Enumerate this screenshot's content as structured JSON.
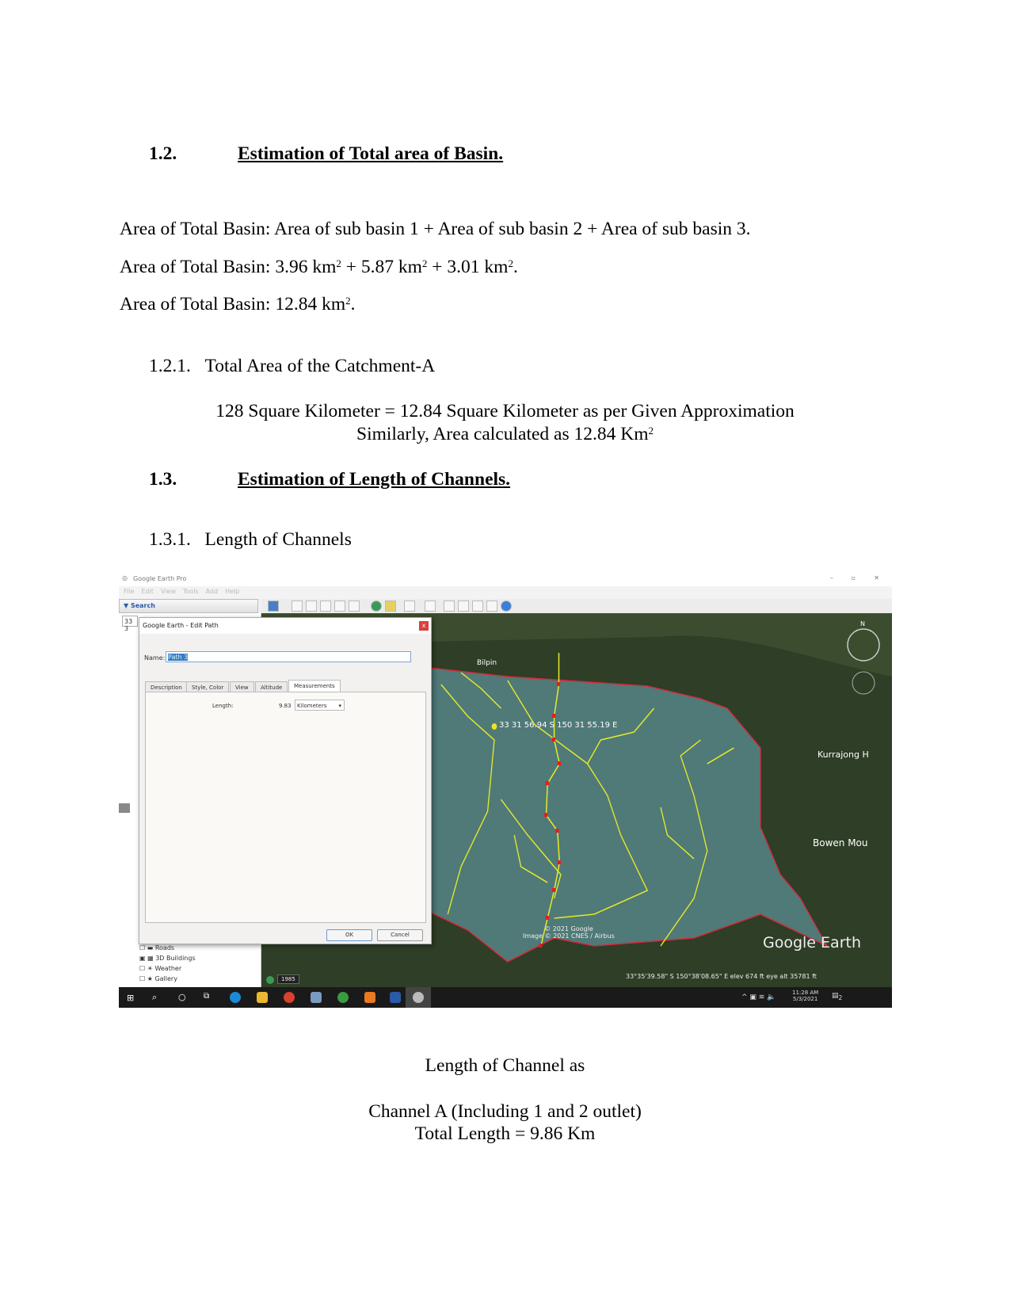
{
  "section_1_2": {
    "number": "1.2.",
    "title": "Estimation of Total area of Basin."
  },
  "paragraphs": {
    "line1": "Area of Total Basin: Area of sub basin 1 + Area of sub basin 2 + Area of sub basin 3.",
    "line2_prefix": "Area of Total Basin: 3.96 km",
    "line2_a": " + 5.87 km",
    "line2_b": " + 3.01 km",
    "line2_end": ".",
    "line3_prefix": "Area of Total Basin: 12.84 km",
    "line3_end": ".",
    "sup": "2"
  },
  "section_1_2_1": {
    "number": "1.2.1.",
    "title": "Total Area of the Catchment-A"
  },
  "catchment": {
    "line1": "128 Square Kilometer = 12.84 Square Kilometer as per Given Approximation",
    "line2": "Similarly, Area calculated as 12.84 Km",
    "sup": "2"
  },
  "section_1_3": {
    "number": "1.3.",
    "title": "Estimation of Length of Channels."
  },
  "section_1_3_1": {
    "number": "1.3.1.",
    "title": "Length of Channels"
  },
  "screenshot": {
    "app_title": "Google Earth Pro",
    "menu": [
      "File",
      "Edit",
      "View",
      "Tools",
      "Add",
      "Help"
    ],
    "search_label": "▼ Search",
    "search_value": "33 3",
    "dialog": {
      "title": "Google Earth - Edit Path",
      "close": "x",
      "name_label": "Name:",
      "name_value": "Path 3",
      "tabs": [
        "Description",
        "Style, Color",
        "View",
        "Altitude",
        "Measurements"
      ],
      "active_tab": "Measurements",
      "length_label": "Length:",
      "length_value": "9.83",
      "unit": "Kilometers",
      "ok": "OK",
      "cancel": "Cancel"
    },
    "layers": [
      "Roads",
      "3D Buildings",
      "Weather",
      "Gallery"
    ],
    "map": {
      "placemark_label": "33 31 56.94 S 150 31 55.19 E",
      "places": [
        "Bilpin",
        "Kurrajong H",
        "Bowen Mou"
      ],
      "copyright1": "© 2021 Google",
      "copyright2": "Image © 2021 CNES / Airbus",
      "logo": "Google Earth",
      "historical_year": "1985",
      "compass_n": "N",
      "status": "33°35'39.58\" S  150°38'08.65\" E  elev  674 ft     eye alt  35781 ft"
    },
    "taskbar": {
      "time": "11:28 AM",
      "date": "5/3/2021",
      "notifications": "2"
    }
  },
  "caption": {
    "line1": "Length of Channel as",
    "line2": "Channel A (Including 1 and 2 outlet)",
    "line3": "Total Length = 9.86 Km"
  }
}
